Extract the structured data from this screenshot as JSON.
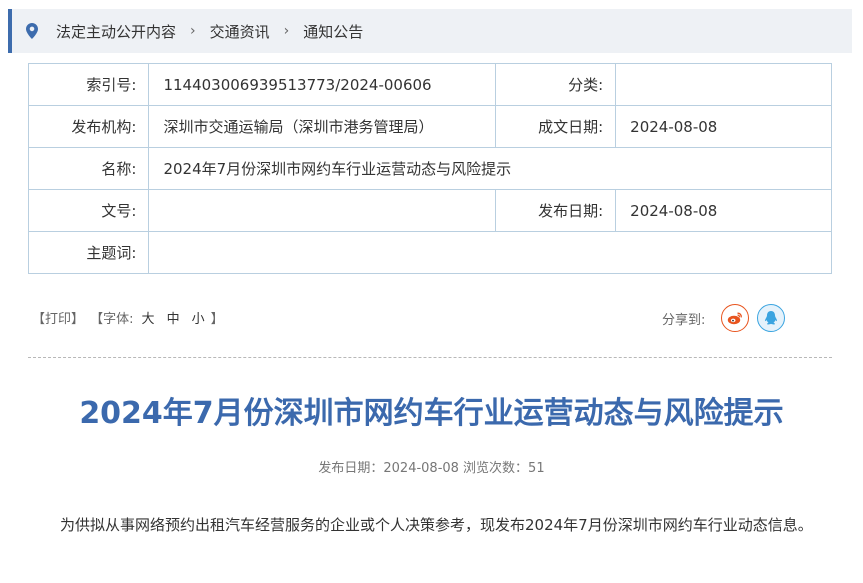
{
  "breadcrumb": {
    "items": [
      "法定主动公开内容",
      "交通资讯",
      "通知公告"
    ]
  },
  "meta": {
    "index_label": "索引号:",
    "index_value": "11440300693951377​3/2024-00606",
    "category_label": "分类:",
    "category_value": "",
    "publisher_label": "发布机构:",
    "publisher_value": "深圳市交通运输局（深圳市港务管理局）",
    "written_date_label": "成文日期:",
    "written_date_value": "2024-08-08",
    "name_label": "名称:",
    "name_value": "2024年7月份深圳市网约车行业运营动态与风险提示",
    "doc_no_label": "文号:",
    "doc_no_value": "",
    "pub_date_label": "发布日期:",
    "pub_date_value": "2024-08-08",
    "subject_label": "主题词:",
    "subject_value": ""
  },
  "tools": {
    "print": "【打印】",
    "font_open": "【字体:",
    "font_large": "大",
    "font_medium": "中",
    "font_small": "小",
    "font_close": "】",
    "share_label": "分享到:"
  },
  "colors": {
    "accent": "#3b69ad",
    "weibo": "#e8541e",
    "qq": "#3aa4e0"
  },
  "article": {
    "title": "2024年7月份深圳市网约车行业运营动态与风险提示",
    "pub_info": "发布日期：2024-08-08  浏览次数：51",
    "body": "为供拟从事网络预约出租汽车经营服务的企业或个人决策参考，现发布2024年7月份深圳市网约车行业动态信息。"
  }
}
